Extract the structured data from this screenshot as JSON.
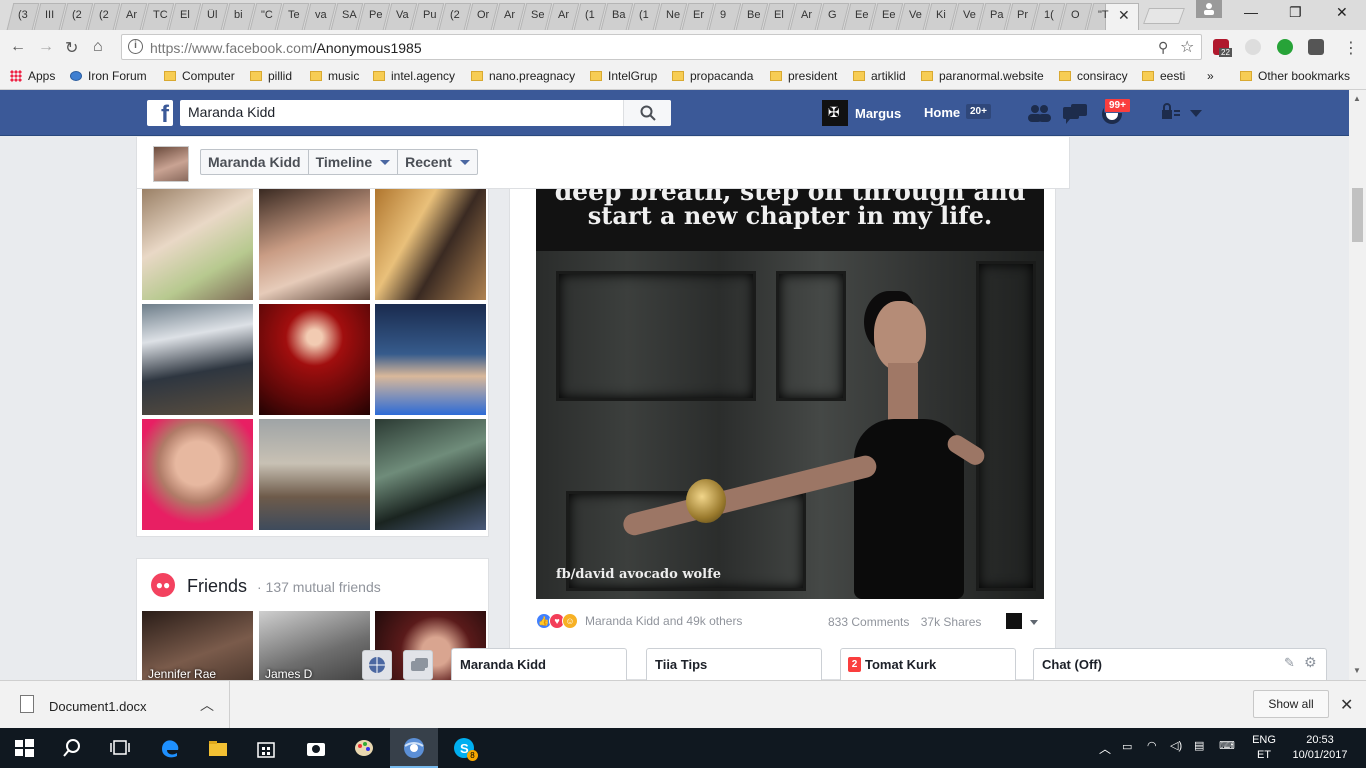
{
  "browser": {
    "tabs": [
      "(3",
      "III",
      "(2",
      "(2",
      "Ar",
      "TC",
      "El",
      "Ül",
      "bi",
      "\"C",
      "Te",
      "va",
      "SA",
      "Pe",
      "Va",
      "Pu",
      "(2",
      "Or",
      "Ar",
      "Se",
      "Ar",
      "(1",
      "Ba",
      "(1",
      "Ne",
      "Er",
      "9",
      "Be",
      "El",
      "Ar",
      "G",
      "Ee",
      "Ee",
      "Ve",
      "Ki",
      "Ve",
      "Pa",
      "Pr",
      "1(",
      "O",
      "\"T"
    ],
    "active_tab_close": "✕",
    "url_host": "https://www.facebook.com",
    "url_path": "/Anonymous1985",
    "extension_badge": "22",
    "bookmarks": [
      {
        "label": "Apps",
        "type": "apps"
      },
      {
        "label": "Iron Forum",
        "type": "globe"
      },
      {
        "label": "Computer",
        "type": "folder"
      },
      {
        "label": "pillid",
        "type": "folder"
      },
      {
        "label": "music",
        "type": "folder"
      },
      {
        "label": "intel.agency",
        "type": "folder"
      },
      {
        "label": "nano.preagnacy",
        "type": "folder"
      },
      {
        "label": "IntelGrup",
        "type": "folder"
      },
      {
        "label": "propacanda",
        "type": "folder"
      },
      {
        "label": "president",
        "type": "folder"
      },
      {
        "label": "artiklid",
        "type": "folder"
      },
      {
        "label": "paranormal.website",
        "type": "folder"
      },
      {
        "label": "consiracy",
        "type": "folder"
      },
      {
        "label": "eesti",
        "type": "folder"
      }
    ],
    "bookmarks_overflow": "»",
    "other_bookmarks": "Other bookmarks"
  },
  "facebook": {
    "logo_letter": "f",
    "search_value": "Maranda Kidd",
    "user_name": "Margus",
    "home_label": "Home",
    "home_badge": "20+",
    "notif_badge": "99+",
    "profile_breadcrumbs": {
      "name": "Maranda Kidd",
      "timeline": "Timeline",
      "recent": "Recent"
    },
    "friends": {
      "title": "Friends",
      "subtitle": "· 137 mutual friends",
      "names": [
        "Jennifer Rae",
        "James D",
        ""
      ]
    },
    "post": {
      "quote_line1": "deep breath, step on through and",
      "quote_line2": "start a new chapter in my life.",
      "watermark": "fb/david avocado wolfe",
      "reactions_text": "Maranda Kidd and 49k others",
      "comments": "833 Comments",
      "shares": "37k Shares"
    },
    "chat_tabs": [
      {
        "label": "Maranda Kidd",
        "badge": ""
      },
      {
        "label": "Tiia Tips",
        "badge": ""
      },
      {
        "label": "Tomat Kurk",
        "badge": "2"
      },
      {
        "label": "Chat (Off)",
        "badge": ""
      }
    ]
  },
  "downloads": {
    "file_name": "Document1.docx",
    "show_all": "Show all"
  },
  "taskbar": {
    "language": "ENG",
    "layout": "ET",
    "time": "20:53",
    "date": "10/01/2017",
    "skype_badge": "8"
  },
  "colors": {
    "fb_blue": "#3b5998",
    "fb_bg": "#e9ebee",
    "badge_red": "#fa3e3e",
    "taskbar": "#101820"
  }
}
